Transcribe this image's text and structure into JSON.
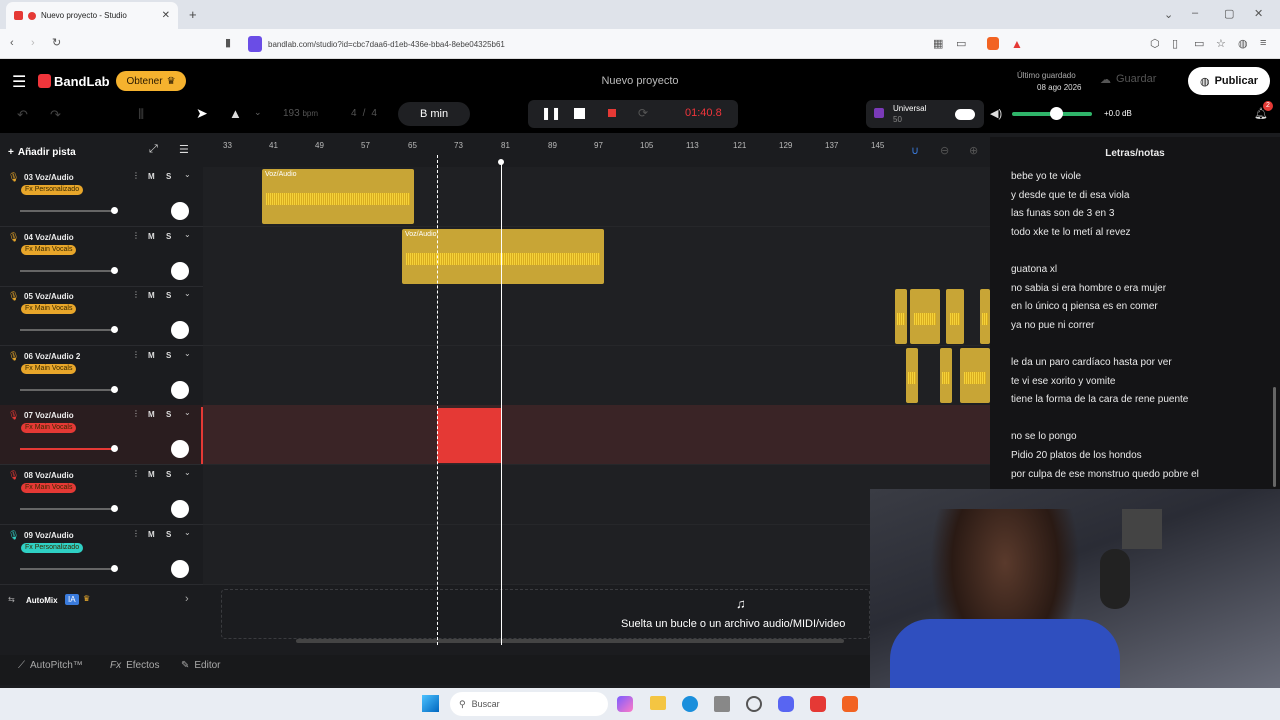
{
  "browser": {
    "tab_title": "Nuevo proyecto - Studio",
    "url": "bandlab.com/studio?id=cbc7daa6-d1eb-436e-bba4-8ebe04325b61",
    "new_tab": "+"
  },
  "app": {
    "brand": "BandLab",
    "obtain_label": "Obtener",
    "project_title": "Nuevo proyecto",
    "last_saved_label": "Último guardado",
    "last_saved_date": "08 ago 2026",
    "save_label": "Guardar",
    "publish_label": "Publicar"
  },
  "toolbar": {
    "bpm": "193",
    "bpm_unit": "bpm",
    "time_sig_num": "4",
    "time_sig_sep": "/",
    "time_sig_den": "4",
    "key": "B min",
    "time": "01:40.8",
    "universal_label": "Universal",
    "universal_value": "50",
    "volume_db": "+0.0 dB",
    "notif_count": "2"
  },
  "ruler": {
    "labels": [
      "33",
      "41",
      "49",
      "57",
      "65",
      "73",
      "81",
      "89",
      "97",
      "105",
      "113",
      "121",
      "129",
      "137",
      "145"
    ]
  },
  "track_header": {
    "add_track": "Añadir pista"
  },
  "tracks": [
    {
      "name": "03  Voz/Audio",
      "fx": "Fx Personalizado",
      "fx_color": "#e8a62a"
    },
    {
      "name": "04  Voz/Audio",
      "fx": "Fx Main Vocals",
      "fx_color": "#e8a62a"
    },
    {
      "name": "05  Voz/Audio",
      "fx": "Fx Main Vocals",
      "fx_color": "#e8a62a"
    },
    {
      "name": "06  Voz/Audio 2",
      "fx": "Fx Main Vocals",
      "fx_color": "#e8a62a"
    },
    {
      "name": "07  Voz/Audio",
      "fx": "Fx Main Vocals",
      "fx_color": "#e53935"
    },
    {
      "name": "08  Voz/Audio",
      "fx": "Fx Main Vocals",
      "fx_color": "#e53935"
    },
    {
      "name": "09  Voz/Audio",
      "fx": "Fx Personalizado",
      "fx_color": "#2fd0c4"
    }
  ],
  "track_buttons": {
    "m": "M",
    "s": "S"
  },
  "clips": {
    "clip1_label": "Voz/Audio",
    "clip2_label": "Voz/Audio"
  },
  "automix": {
    "label": "AutoMix",
    "badge": "IA"
  },
  "dropzone": {
    "text": "Suelta un bucle o un archivo audio/MIDI/video"
  },
  "bottom_tabs": {
    "autopitch": "AutoPitch™",
    "effects": "Efectos",
    "editor": "Editor"
  },
  "lyrics": {
    "title": "Letras/notas",
    "lines": [
      "bebe yo te viole",
      "y desde que te di esa viola",
      "las funas son de 3 en 3",
      "todo xke te lo metí al revez",
      "",
      "guatona xl",
      "no sabia si era hombre o era mujer",
      "en lo único q piensa es en comer",
      "ya no pue ni correr",
      "",
      "le da un paro cardíaco hasta por ver",
      "te vi ese xorito y vomite",
      "tiene la forma de la cara de rene puente",
      "",
      "no se lo pongo",
      "Pidio 20 platos de los hondos",
      "por culpa de ese monstruo quedo pobre el"
    ]
  },
  "taskbar": {
    "search_placeholder": "Buscar"
  }
}
